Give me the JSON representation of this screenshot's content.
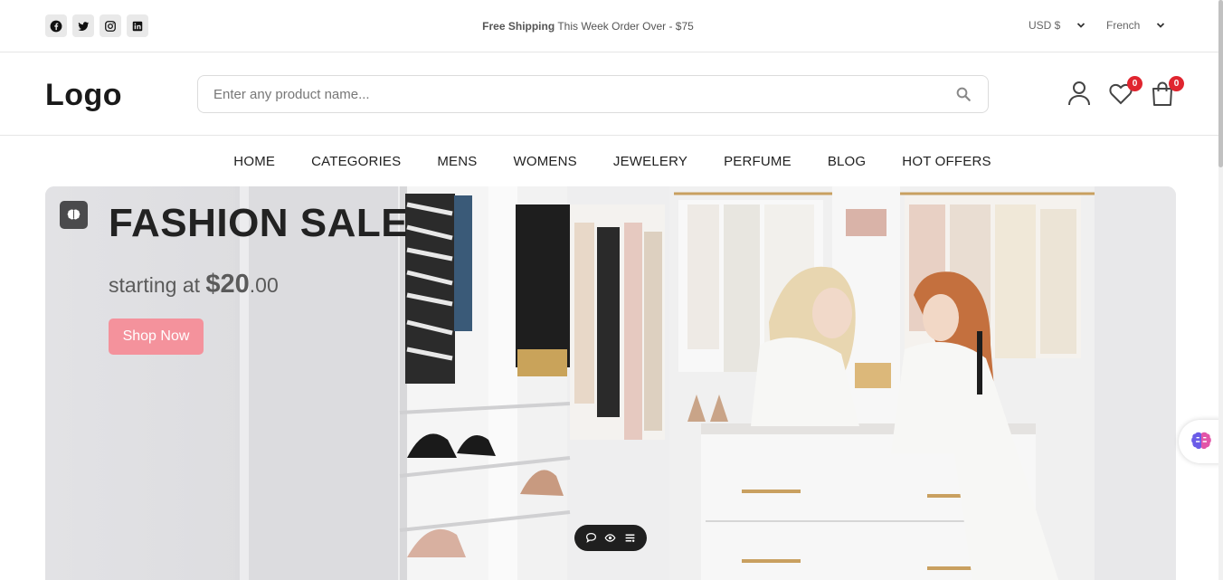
{
  "topbar": {
    "social": [
      {
        "name": "facebook-icon"
      },
      {
        "name": "twitter-icon"
      },
      {
        "name": "instagram-icon"
      },
      {
        "name": "linkedin-icon"
      }
    ],
    "promo_bold": "Free Shipping",
    "promo_text": "This Week Order Over - $75",
    "currency": "USD $",
    "language": "French"
  },
  "header": {
    "logo": "Logo",
    "search_placeholder": "Enter any product name...",
    "wishlist_count": "0",
    "cart_count": "0"
  },
  "nav": {
    "items": [
      "HOME",
      "CATEGORIES",
      "MENS",
      "WOMENS",
      "JEWELERY",
      "PERFUME",
      "BLOG",
      "HOT OFFERS"
    ]
  },
  "hero": {
    "title": "FASHION SALE",
    "subtitle_prefix": "starting at",
    "price": "$20",
    "cents": ".00",
    "button": "Shop Now"
  },
  "colors": {
    "badge": "#e0252f",
    "button": "#f4929c"
  }
}
